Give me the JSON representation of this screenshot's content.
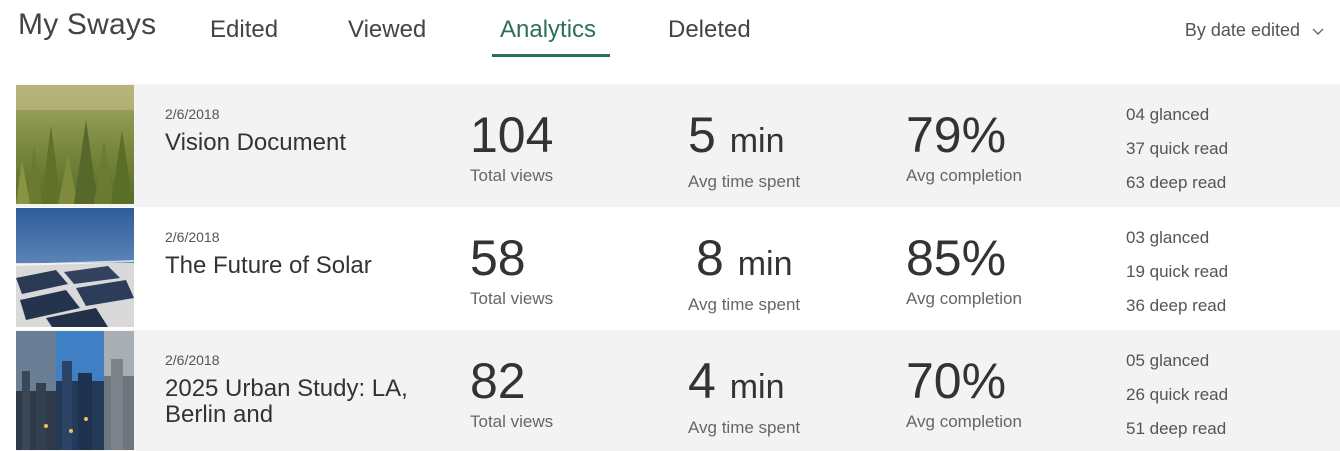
{
  "header": {
    "title": "My Sways",
    "tabs": [
      {
        "label": "Edited"
      },
      {
        "label": "Viewed"
      },
      {
        "label": "Analytics"
      },
      {
        "label": "Deleted"
      }
    ],
    "sort_label": "By date edited"
  },
  "rows": [
    {
      "date": "2/6/2018",
      "title": "Vision Document",
      "total_views": "104",
      "total_views_label": "Total views",
      "avg_time_value": "5",
      "avg_time_unit": "min",
      "avg_time_label": "Avg time spent",
      "avg_completion": "79%",
      "avg_completion_label": "Avg completion",
      "glanced": "04 glanced",
      "quick_read": "37 quick read",
      "deep_read": "63 deep read",
      "thumbnail": "forest-image"
    },
    {
      "date": "2/6/2018",
      "title": "The Future of Solar",
      "total_views": "58",
      "total_views_label": "Total views",
      "avg_time_value": "8",
      "avg_time_unit": "min",
      "avg_time_label": "Avg time spent",
      "avg_completion": "85%",
      "avg_completion_label": "Avg completion",
      "glanced": "03 glanced",
      "quick_read": "19 quick read",
      "deep_read": "36 deep read",
      "thumbnail": "solar-panels-image"
    },
    {
      "date": "2/6/2018",
      "title": "2025 Urban Study: LA, Berlin and",
      "total_views": "82",
      "total_views_label": "Total views",
      "avg_time_value": "4",
      "avg_time_unit": "min",
      "avg_time_label": "Avg time spent",
      "avg_completion": "70%",
      "avg_completion_label": "Avg completion",
      "glanced": "05 glanced",
      "quick_read": "26 quick read",
      "deep_read": "51 deep read",
      "thumbnail": "city-skyline-image"
    }
  ],
  "colors": {
    "accent": "#2c6e5f",
    "row_alt_bg": "#f3f3f3"
  }
}
